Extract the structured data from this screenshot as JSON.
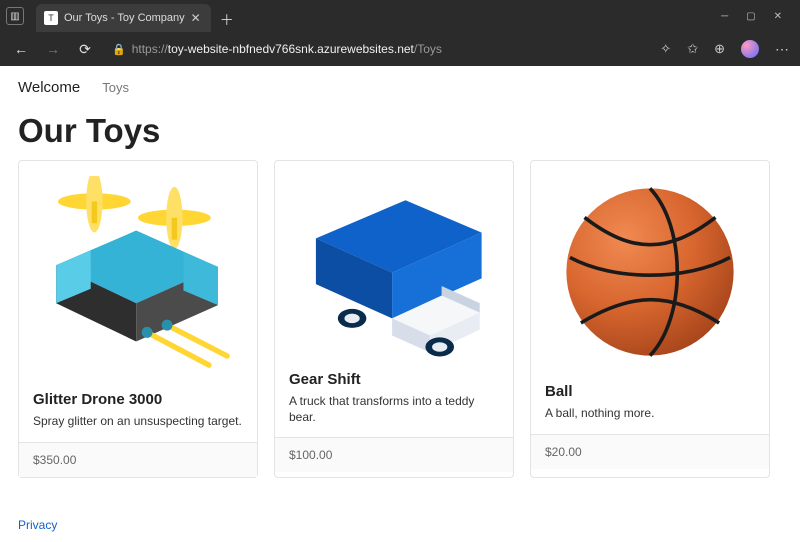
{
  "browser": {
    "tab_title": "Our Toys - Toy Company",
    "url_scheme": "https://",
    "url_host": "toy-website-nbfnedv766snk.azurewebsites.net",
    "url_path": "/Toys"
  },
  "nav": {
    "brand": "Welcome",
    "link_toys": "Toys"
  },
  "page_title": "Our Toys",
  "products": [
    {
      "name": "Glitter Drone 3000",
      "desc": "Spray glitter on an unsuspecting target.",
      "price": "$350.00"
    },
    {
      "name": "Gear Shift",
      "desc": "A truck that transforms into a teddy bear.",
      "price": "$100.00"
    },
    {
      "name": "Ball",
      "desc": "A ball, nothing more.",
      "price": "$20.00"
    }
  ],
  "footer": {
    "privacy": "Privacy"
  }
}
